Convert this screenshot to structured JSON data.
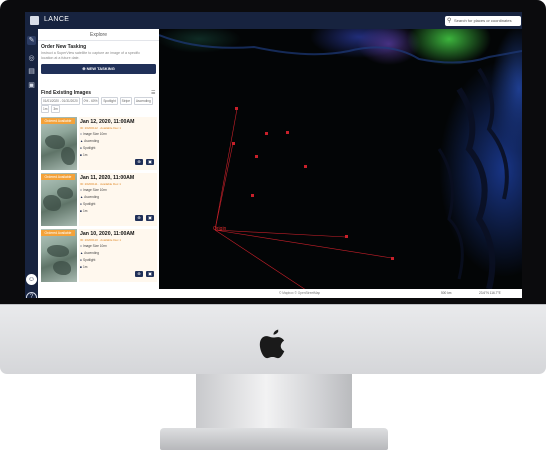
{
  "app": {
    "name": "LANCE"
  },
  "search": {
    "placeholder": "Search for places or coordinates"
  },
  "panel": {
    "title": "Explore",
    "order_title": "Order New Tasking",
    "order_desc": "Instruct a SuperView satellite to capture an image of a specific location at a future date.",
    "new_tasking_label": "NEW TASKING",
    "find_title": "Find Existing Images",
    "chips": [
      "01/01/2020 - 01/31/2020",
      "0% - 60%",
      "Spotlight",
      "Stripe",
      "Ascending",
      "1m",
      "3m"
    ]
  },
  "cards": [
    {
      "badge": "Ordered Available",
      "date": "Jan 12, 2020, 11:00AM",
      "sub": "ID: 20200112 · Available Dec 1",
      "meta": [
        "Image Size 10m²",
        "Ascending",
        "Spotlight",
        "1m"
      ]
    },
    {
      "badge": "Ordered Available",
      "date": "Jan 11, 2020, 11:00AM",
      "sub": "ID: 20200111 · Available Dec 1",
      "meta": [
        "Image Size 10m²",
        "Ascending",
        "Spotlight",
        "1m"
      ]
    },
    {
      "badge": "Ordered Available",
      "date": "Jan 10, 2020, 11:00AM",
      "sub": "ID: 20200110 · Available Dec 1",
      "meta": [
        "Image Size 10m²",
        "Ascending",
        "Spotlight",
        "1m"
      ]
    }
  ],
  "map": {
    "origin_label": "Origin",
    "attribution": "© Mapbox © OpenStreetMap",
    "scale": "500 km",
    "coordinates": "23.6°N 116.7°E"
  },
  "icons": {
    "nav": [
      "pencil-icon",
      "globe-icon",
      "document-icon",
      "image-icon"
    ],
    "map_controls": [
      "arrow-icon",
      "layers-icon",
      "polygon-icon",
      "trash-icon",
      "plus-icon",
      "minus-icon",
      "compass-icon"
    ]
  },
  "colors": {
    "nav": "#17233f",
    "accent": "#203058",
    "badge": "#f4a23a",
    "route": "#c8202a"
  }
}
